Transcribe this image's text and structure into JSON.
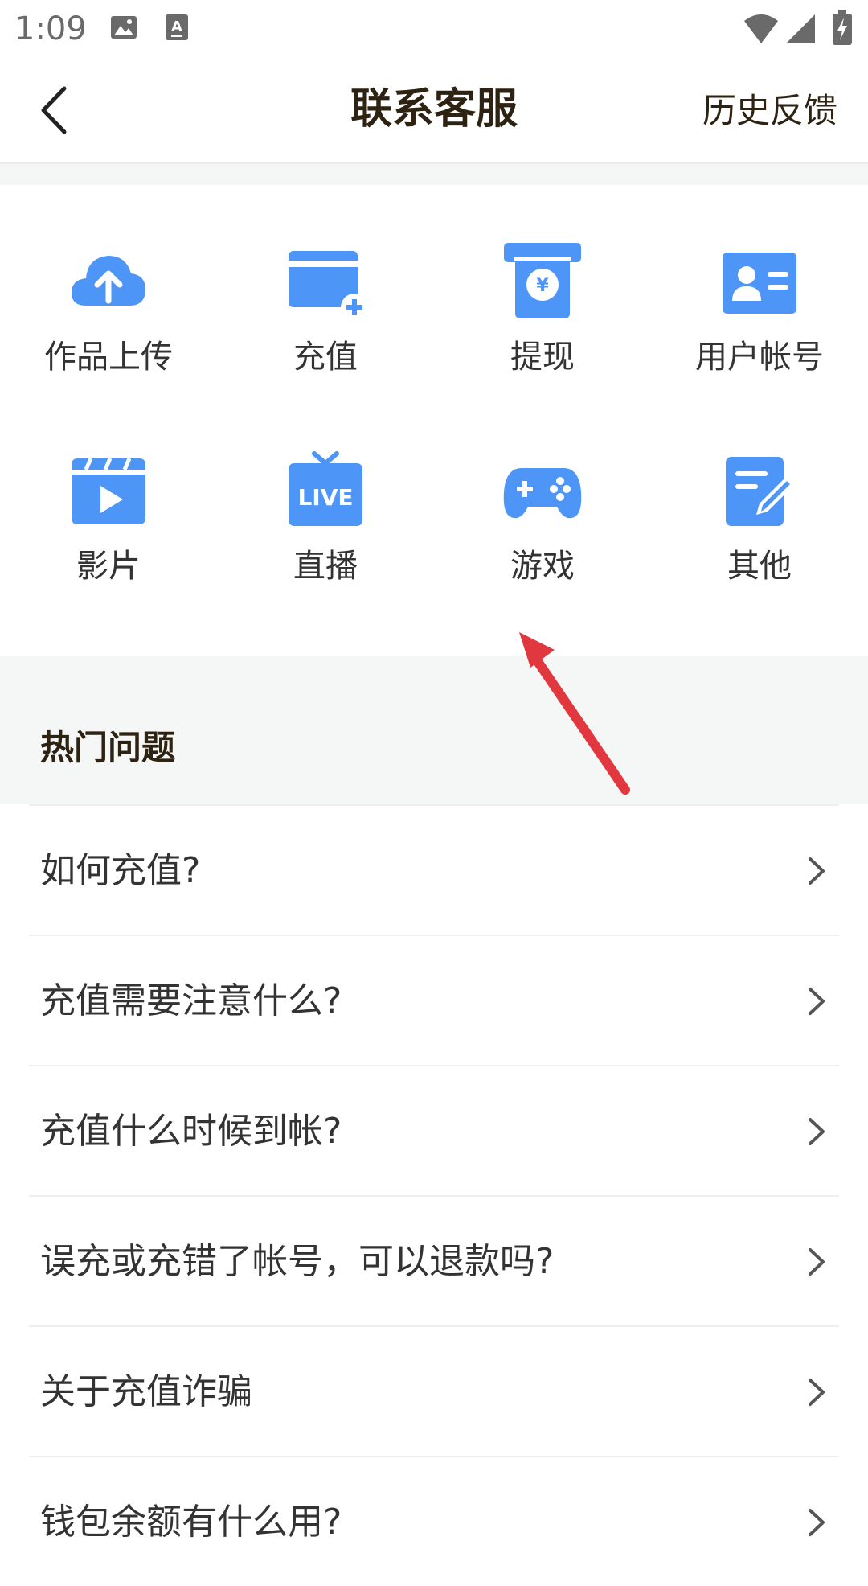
{
  "status_bar": {
    "time": "1:09"
  },
  "header": {
    "title": "联系客服",
    "history": "历史反馈"
  },
  "categories": [
    {
      "label": "作品上传",
      "icon": "cloud-upload-icon"
    },
    {
      "label": "充值",
      "icon": "card-add-icon"
    },
    {
      "label": "提现",
      "icon": "withdraw-icon"
    },
    {
      "label": "用户帐号",
      "icon": "id-card-icon"
    },
    {
      "label": "影片",
      "icon": "clapperboard-icon"
    },
    {
      "label": "直播",
      "icon": "live-tv-icon"
    },
    {
      "label": "游戏",
      "icon": "gamepad-icon"
    },
    {
      "label": "其他",
      "icon": "note-edit-icon"
    }
  ],
  "hot_section": {
    "title": "热门问题"
  },
  "faq": [
    "如何充值?",
    "充值需要注意什么?",
    "充值什么时候到帐?",
    "误充或充错了帐号，可以退款吗?",
    "关于充值诈骗",
    "钱包余额有什么用?"
  ],
  "colors": {
    "accent": "#4d95f6",
    "title_text": "#2e2212",
    "annotation_arrow": "#e0383e"
  },
  "icon_texts": {
    "live": "LIVE",
    "yen": "¥"
  }
}
